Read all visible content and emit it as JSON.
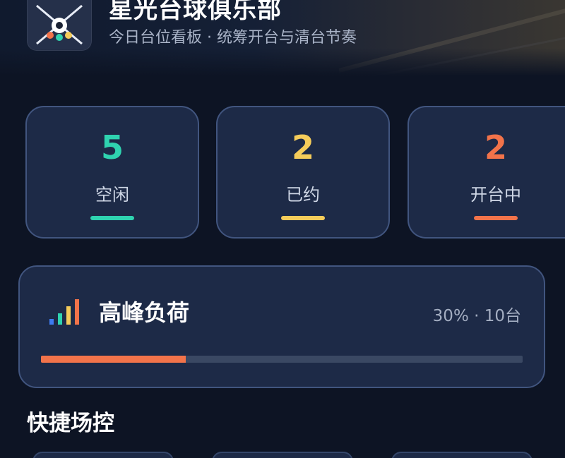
{
  "header": {
    "club_name": "星光台球俱乐部",
    "subtitle": "今日台位看板 · 统筹开台与清台节奏"
  },
  "stats": [
    {
      "value": "5",
      "label": "空闲",
      "color": "#2fd3b0"
    },
    {
      "value": "2",
      "label": "已约",
      "color": "#f5cc5a"
    },
    {
      "value": "2",
      "label": "开台中",
      "color": "#f2734a"
    }
  ],
  "peak": {
    "title": "高峰负荷",
    "meta": "30% · 10台",
    "load_fraction": 0.3,
    "fill_color": "#f2734a"
  },
  "quick_control": {
    "title": "快捷场控"
  }
}
